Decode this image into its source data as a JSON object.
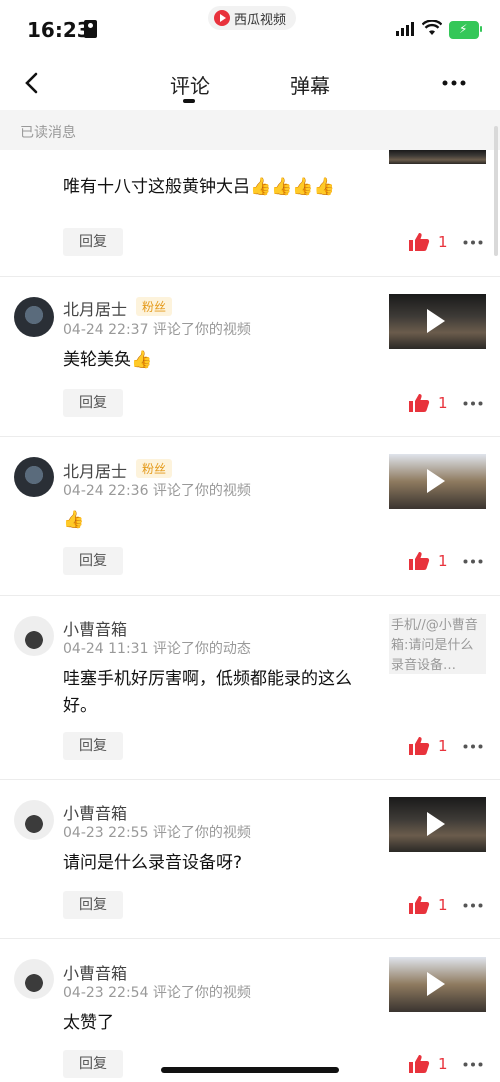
{
  "status_bar": {
    "time": "16:23",
    "app_name": "西瓜视频"
  },
  "nav": {
    "tab_comments": "评论",
    "tab_danmaku": "弹幕"
  },
  "section": {
    "label": "已读消息"
  },
  "items": [
    {
      "text": "唯有十八寸这般黄钟大吕👍👍👍👍",
      "reply": "回复",
      "likes": "1"
    },
    {
      "name": "北月居士",
      "badge": "粉丝",
      "meta": "04-24 22:37 评论了你的视频",
      "text": "美轮美奂👍",
      "reply": "回复",
      "likes": "1"
    },
    {
      "name": "北月居士",
      "badge": "粉丝",
      "meta": "04-24 22:36 评论了你的视频",
      "text": "👍",
      "reply": "回复",
      "likes": "1"
    },
    {
      "name": "小曹音箱",
      "meta": "04-24 11:31 评论了你的动态",
      "text": "哇塞手机好厉害啊，低频都能录的这么好。",
      "thumb_text": "手机//@小曹音箱:请问是什么录音设备…",
      "reply": "回复",
      "likes": "1"
    },
    {
      "name": "小曹音箱",
      "meta": "04-23 22:55 评论了你的视频",
      "text": "请问是什么录音设备呀?",
      "reply": "回复",
      "likes": "1"
    },
    {
      "name": "小曹音箱",
      "meta": "04-23 22:54 评论了你的视频",
      "text": "太赞了",
      "reply": "回复",
      "likes": "1"
    }
  ],
  "colors": {
    "accent": "#e8333c",
    "badge": "#e49a1b"
  }
}
